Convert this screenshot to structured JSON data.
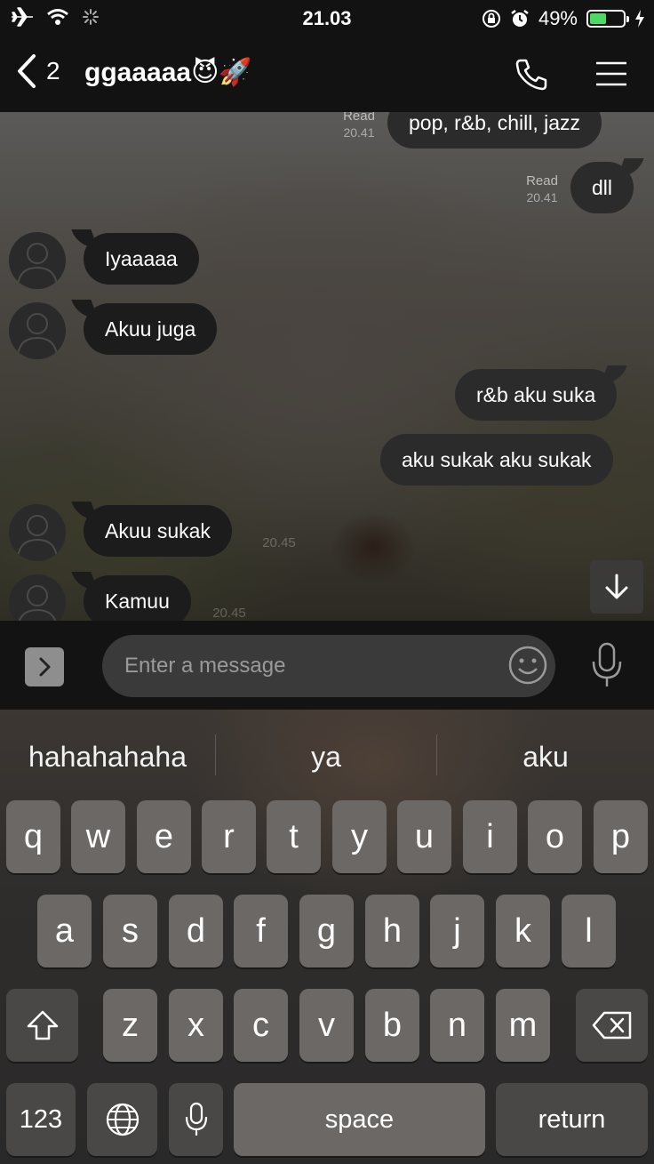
{
  "status_bar": {
    "time": "21.03",
    "battery_percent": "49%",
    "battery_level": 0.49,
    "icons": [
      "airplane-icon",
      "wifi-icon",
      "activity-spinner-icon",
      "orientation-lock-icon",
      "alarm-icon",
      "battery-icon",
      "charging-icon"
    ]
  },
  "header": {
    "back_count": "2",
    "title": "ggaaaaa😈🚀",
    "icons": [
      "back-chevron-icon",
      "phone-icon",
      "menu-icon"
    ]
  },
  "messages": [
    {
      "direction": "out",
      "text": "pop, r&b, chill, jazz",
      "status": "Read",
      "time": "20.41"
    },
    {
      "direction": "out",
      "text": "dll",
      "status": "Read",
      "time": "20.41"
    },
    {
      "direction": "in",
      "text": "Iyaaaaa"
    },
    {
      "direction": "in",
      "text": "Akuu juga"
    },
    {
      "direction": "out",
      "text": "r&b aku suka"
    },
    {
      "direction": "out",
      "text": "aku sukak aku sukak"
    },
    {
      "direction": "in",
      "text": "Akuu sukak",
      "time": "20.45"
    },
    {
      "direction": "in",
      "text": "Kamuu",
      "time": "20.45"
    }
  ],
  "input": {
    "placeholder": "Enter a message",
    "icons": [
      "chevron-right-icon",
      "emoji-icon",
      "microphone-icon"
    ]
  },
  "keyboard": {
    "suggestions": [
      "hahahahaha",
      "ya",
      "aku"
    ],
    "row1": [
      "q",
      "w",
      "e",
      "r",
      "t",
      "y",
      "u",
      "i",
      "o",
      "p"
    ],
    "row2": [
      "a",
      "s",
      "d",
      "f",
      "g",
      "h",
      "j",
      "k",
      "l"
    ],
    "row3": [
      "z",
      "x",
      "c",
      "v",
      "b",
      "n",
      "m"
    ],
    "numbers_label": "123",
    "space_label": "space",
    "return_label": "return"
  }
}
